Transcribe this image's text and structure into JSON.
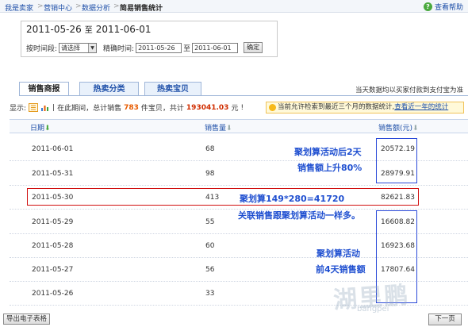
{
  "breadcrumb": {
    "items": [
      "我是卖家",
      "营销中心",
      "数据分析",
      "简易销售统计"
    ],
    "separator": ">"
  },
  "help": {
    "label": "查看帮助",
    "icon": "question-icon"
  },
  "date_panel": {
    "start_date": "2011-05-26",
    "to_label": "至",
    "end_date": "2011-06-01",
    "period_label": "按时间段:",
    "period_select": "请选择",
    "exact_label": "精确时间:",
    "exact_start": "2011-05-26",
    "exact_to": "至",
    "exact_end": "2011-06-01",
    "confirm_label": "确定"
  },
  "tabs": [
    {
      "label": "销售商报",
      "active": true
    },
    {
      "label": "热卖分类",
      "active": false
    },
    {
      "label": "热卖宝贝",
      "active": false
    }
  ],
  "tab_note": "当天数据均以买家付款到支付宝为准",
  "summary": {
    "display_label": "显示:",
    "prefix": "在此期间，总计销售",
    "count": "783",
    "middle": "件宝贝，共计",
    "total": "193041.03",
    "unit": "元",
    "suffix": "!"
  },
  "notice": {
    "text": "当前允许检索到最近三个月的数据统计,",
    "link": "查看近一年的统计"
  },
  "table": {
    "headers": {
      "date": "日期",
      "qty": "销售量",
      "amount": "销售额(元)"
    },
    "rows": [
      {
        "date": "2011-06-01",
        "qty": "68",
        "amount": "20572.19"
      },
      {
        "date": "2011-05-31",
        "qty": "98",
        "amount": "28979.91"
      },
      {
        "date": "2011-05-30",
        "qty": "413",
        "amount": "82621.83"
      },
      {
        "date": "2011-05-29",
        "qty": "55",
        "amount": "16608.82"
      },
      {
        "date": "2011-05-28",
        "qty": "60",
        "amount": "16923.68"
      },
      {
        "date": "2011-05-27",
        "qty": "56",
        "amount": "17807.64"
      },
      {
        "date": "2011-05-26",
        "qty": "33",
        "amount": ""
      }
    ]
  },
  "annotations": {
    "after_line1": "聚划算活动后2天",
    "after_line2": "销售额上升80%",
    "juhuasuan": "聚划算149*280=41720",
    "related": "关联销售跟聚划算活动一样多。",
    "before_line1": "聚划算活动",
    "before_line2": "前4天销售额"
  },
  "bottom": {
    "export_label": "导出电子表格",
    "next_label": "下一页"
  },
  "watermark": {
    "main": "湖里鹏",
    "sub": "bangpei"
  },
  "colors": {
    "link": "#1e4fa8",
    "annotation": "#1f4fd0",
    "highlight_red": "#d01010",
    "orange": "#e85b00"
  }
}
